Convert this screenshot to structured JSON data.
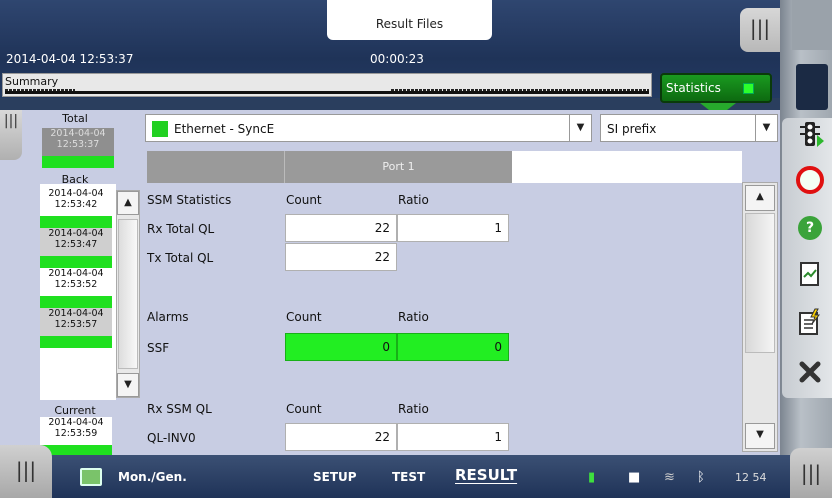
{
  "header": {
    "title": "Result Files",
    "datetime": "2014-04-04 12:53:37",
    "elapsed": "00:00:23",
    "summary_label": "Summary",
    "statistics_label": "Statistics"
  },
  "left_panel": {
    "total_label": "Total",
    "total_card": {
      "date": "2014-04-04",
      "time": "12:53:37"
    },
    "back_label": "Back",
    "back_items": [
      {
        "date": "2014-04-04",
        "time": "12:53:42"
      },
      {
        "date": "2014-04-04",
        "time": "12:53:47"
      },
      {
        "date": "2014-04-04",
        "time": "12:53:52"
      },
      {
        "date": "2014-04-04",
        "time": "12:53:57"
      }
    ],
    "current_label": "Current",
    "current_card": {
      "date": "2014-04-04",
      "time": "12:53:59"
    }
  },
  "selects": {
    "interface": "Ethernet - SyncE",
    "prefix": "SI prefix"
  },
  "grid": {
    "port_header": "Port 1",
    "sections": [
      {
        "title": "SSM Statistics",
        "col1": "Count",
        "col2": "Ratio",
        "rows": [
          {
            "label": "Rx Total QL",
            "count": "22",
            "ratio": "1"
          },
          {
            "label": "Tx Total QL",
            "count": "22",
            "ratio": ""
          }
        ]
      },
      {
        "title": "Alarms",
        "col1": "Count",
        "col2": "Ratio",
        "rows": [
          {
            "label": "SSF",
            "count": "0",
            "ratio": "0"
          }
        ]
      },
      {
        "title": "Rx SSM QL",
        "col1": "Count",
        "col2": "Ratio",
        "rows": [
          {
            "label": "QL-INV0",
            "count": "22",
            "ratio": "1"
          }
        ]
      }
    ]
  },
  "bottom": {
    "mode_label": "Mon./Gen.",
    "nav_setup": "SETUP",
    "nav_test": "TEST",
    "nav_result": "RESULT",
    "clock": "12 54"
  },
  "colors": {
    "status_ok": "#22ee22",
    "header_bg": "#1f3358",
    "panel_bg": "#c8cde3"
  }
}
